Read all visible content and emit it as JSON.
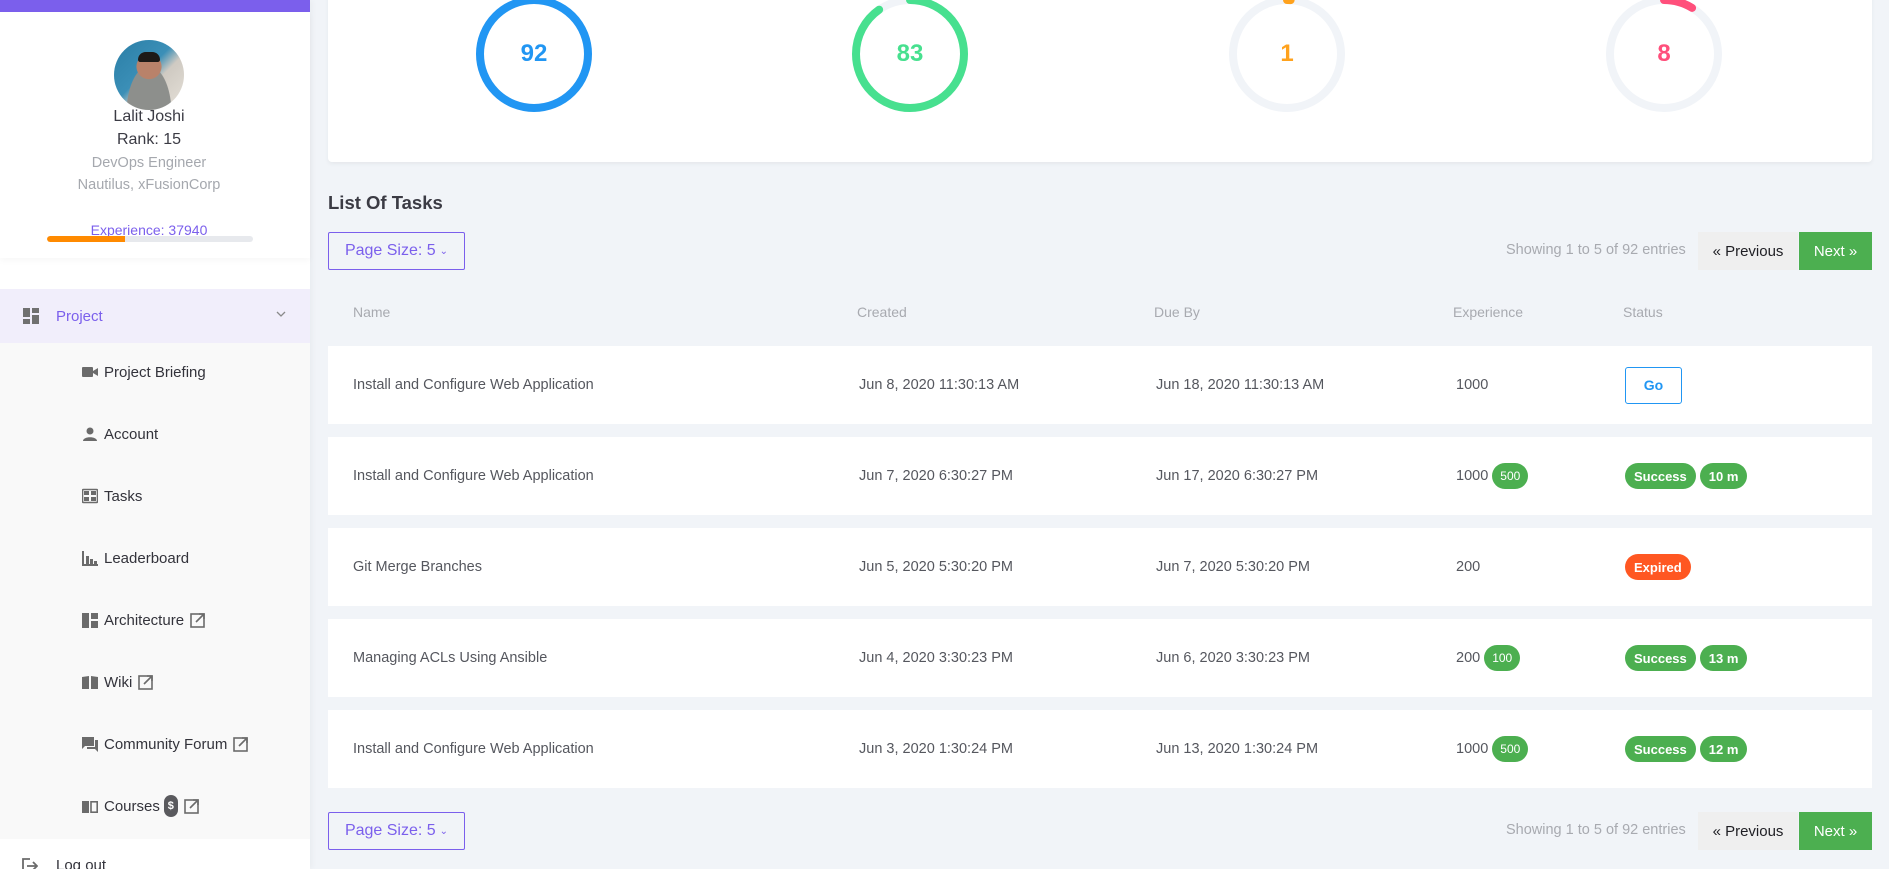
{
  "profile": {
    "name": "Lalit Joshi",
    "rank": "Rank: 15",
    "title": "DevOps Engineer",
    "org": "Nautilus, xFusionCorp",
    "experience_label": "Experience: 37940",
    "experience_progress_pct": 38
  },
  "sidebar": {
    "menu_head": {
      "label": "Project",
      "icon": "dashboard-icon"
    },
    "items": [
      {
        "label": "Project Briefing",
        "icon": "video-camera-icon",
        "external": false
      },
      {
        "label": "Account",
        "icon": "person-icon",
        "external": false
      },
      {
        "label": "Tasks",
        "icon": "table-icon",
        "external": false
      },
      {
        "label": "Leaderboard",
        "icon": "bar-chart-icon",
        "external": false
      },
      {
        "label": "Architecture",
        "icon": "dashboard-icon",
        "external": true
      },
      {
        "label": "Wiki",
        "icon": "book-icon",
        "external": true
      },
      {
        "label": "Community Forum",
        "icon": "forum-icon",
        "external": true
      },
      {
        "label": "Courses",
        "icon": "book-open-icon",
        "external": true,
        "badge": "$"
      }
    ],
    "logout_label": "Log out"
  },
  "stats": [
    {
      "value": "92",
      "total": 92,
      "color": "#2196f3"
    },
    {
      "value": "83",
      "total": 92,
      "color": "#47e08f"
    },
    {
      "value": "1",
      "total": 92,
      "color": "#ffa21d"
    },
    {
      "value": "8",
      "total": 92,
      "color": "#ff4f7b"
    }
  ],
  "track_color": "#f1f4f8",
  "tasks": {
    "title": "List Of Tasks",
    "page_size_label": "Page Size: 5",
    "caret": "⌄",
    "showing": "Showing 1 to 5 of 92 entries",
    "prev_label": "« Previous",
    "next_label": "Next »",
    "columns": [
      "Name",
      "Created",
      "Due By",
      "Experience",
      "Status"
    ],
    "rows": [
      {
        "name": "Install and Configure Web Application",
        "created": "Jun 8, 2020 11:30:13 AM",
        "due": "Jun 18, 2020 11:30:13 AM",
        "experience": "1000",
        "bonus": "",
        "status": "Go",
        "status_type": "go",
        "duration": ""
      },
      {
        "name": "Install and Configure Web Application",
        "created": "Jun 7, 2020 6:30:27 PM",
        "due": "Jun 17, 2020 6:30:27 PM",
        "experience": "1000",
        "bonus": "500",
        "status": "Success",
        "status_type": "success",
        "duration": "10 m"
      },
      {
        "name": "Git Merge Branches",
        "created": "Jun 5, 2020 5:30:20 PM",
        "due": "Jun 7, 2020 5:30:20 PM",
        "experience": "200",
        "bonus": "",
        "status": "Expired",
        "status_type": "expired",
        "duration": ""
      },
      {
        "name": "Managing ACLs Using Ansible",
        "created": "Jun 4, 2020 3:30:23 PM",
        "due": "Jun 6, 2020 3:30:23 PM",
        "experience": "200",
        "bonus": "100",
        "status": "Success",
        "status_type": "success",
        "duration": "13 m"
      },
      {
        "name": "Install and Configure Web Application",
        "created": "Jun 3, 2020 1:30:24 PM",
        "due": "Jun 13, 2020 1:30:24 PM",
        "experience": "1000",
        "bonus": "500",
        "status": "Success",
        "status_type": "success",
        "duration": "12 m"
      }
    ]
  }
}
